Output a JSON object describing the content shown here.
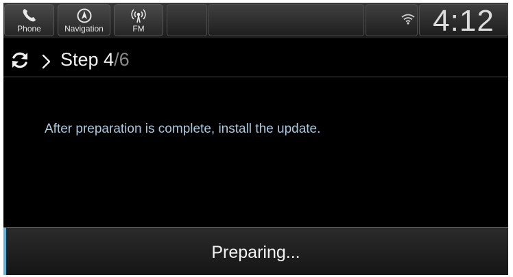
{
  "status_bar": {
    "buttons": [
      {
        "label": "Phone",
        "icon": "phone-icon"
      },
      {
        "label": "Navigation",
        "icon": "compass-icon"
      },
      {
        "label": "FM",
        "icon": "radio-antenna-icon"
      }
    ],
    "wifi_icon": "wifi-icon",
    "clock": "4:12"
  },
  "step": {
    "icon": "sync-icon",
    "separator_icon": "chevron-right-icon",
    "current": "Step 4",
    "total": "/6"
  },
  "message": "After preparation is complete, install the update.",
  "progress": {
    "label": "Preparing..."
  },
  "colors": {
    "accent": "#5fb2e0",
    "message_text": "#a9c9df"
  }
}
